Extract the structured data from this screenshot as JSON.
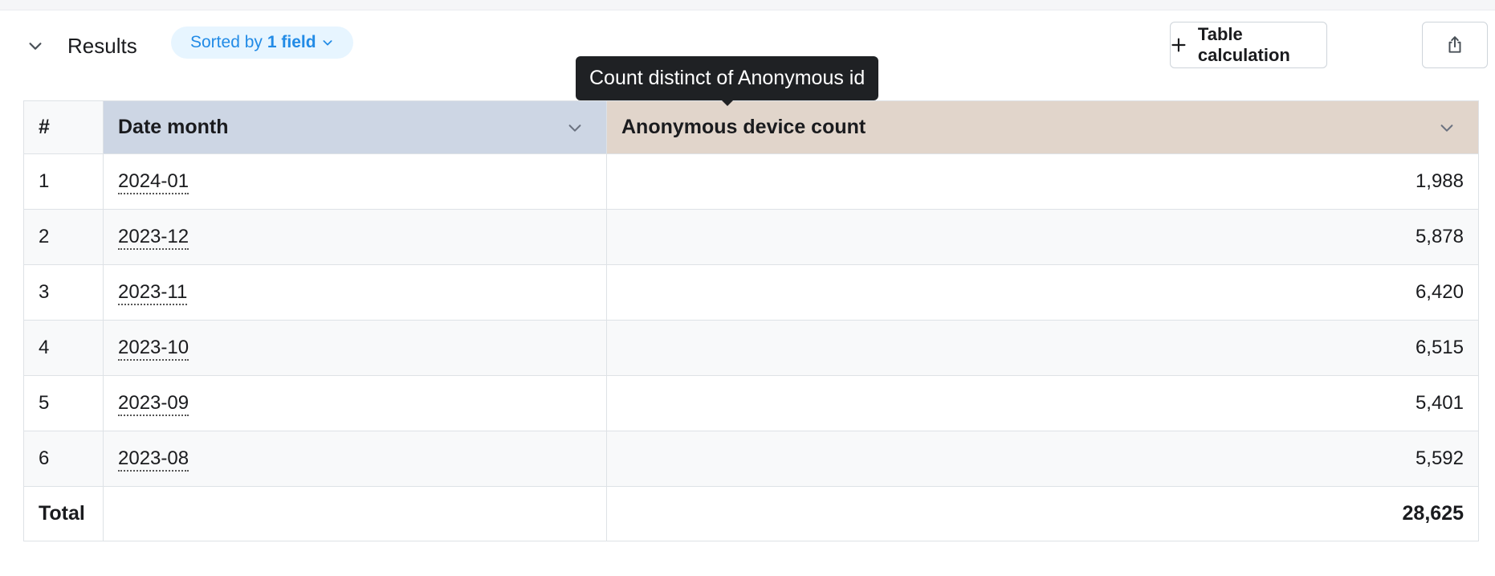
{
  "results": {
    "title": "Results",
    "sort_prefix": "Sorted by",
    "sort_count": "1 field",
    "table_calc_label": "Table calculation"
  },
  "tooltip": {
    "text": "Count distinct of Anonymous id"
  },
  "table": {
    "headers": [
      "#",
      "Date month",
      "Anonymous device count"
    ],
    "rows": [
      {
        "index": "1",
        "date": "2024-01",
        "count": "1,988"
      },
      {
        "index": "2",
        "date": "2023-12",
        "count": "5,878"
      },
      {
        "index": "3",
        "date": "2023-11",
        "count": "6,420"
      },
      {
        "index": "4",
        "date": "2023-10",
        "count": "6,515"
      },
      {
        "index": "5",
        "date": "2023-09",
        "count": "5,401"
      },
      {
        "index": "6",
        "date": "2023-08",
        "count": "5,592"
      }
    ],
    "total_label": "Total",
    "total_value": "28,625"
  },
  "colors": {
    "dimension_header": "#cdd6e4",
    "metric_header": "#e1d5cb",
    "accent": "#228be6"
  },
  "icons": {
    "collapse": "chevron-down-icon",
    "sort": "chevron-down-icon",
    "add": "plus-icon",
    "share": "share-icon"
  }
}
